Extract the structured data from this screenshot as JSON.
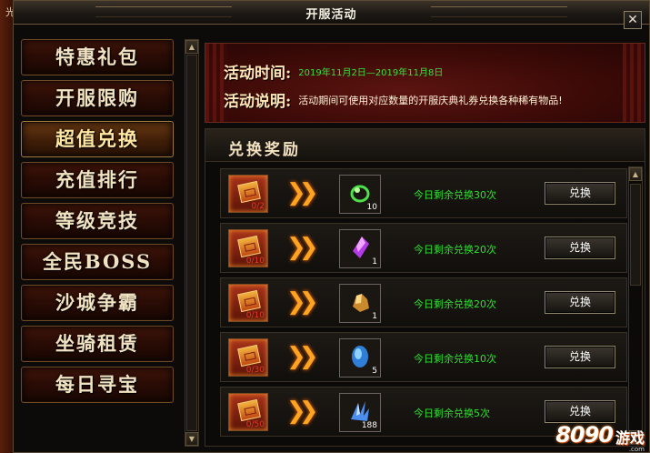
{
  "backdrop_label": "光",
  "window": {
    "title": "开服活动",
    "close_label": "✕"
  },
  "menu": {
    "items": [
      {
        "label": "特惠礼包"
      },
      {
        "label": "开服限购"
      },
      {
        "label": "超值兑换"
      },
      {
        "label": "充值排行"
      },
      {
        "label": "等级竞技"
      },
      {
        "label": "全民BOSS"
      },
      {
        "label": "沙城争霸"
      },
      {
        "label": "坐骑租赁"
      },
      {
        "label": "每日寻宝"
      }
    ],
    "active_index": 2
  },
  "activity": {
    "time_label": "活动时间:",
    "time_value": "2019年11月2日—2019年11月8日",
    "desc_label": "活动说明:",
    "desc_value": "活动期间可使用对应数量的开服庆典礼券兑换各种稀有物品!"
  },
  "rewards": {
    "title": "兑换奖励",
    "rows": [
      {
        "coupon_count": "0/2",
        "item_icon": "green-ring-icon",
        "item_qty": "10",
        "remaining": "今日剩余兑换30次",
        "button": "兑换"
      },
      {
        "coupon_count": "0/10",
        "item_icon": "purple-shard-icon",
        "item_qty": "1",
        "remaining": "今日剩余兑换20次",
        "button": "兑换"
      },
      {
        "coupon_count": "0/10",
        "item_icon": "gold-ore-icon",
        "item_qty": "1",
        "remaining": "今日剩余兑换20次",
        "button": "兑换"
      },
      {
        "coupon_count": "0/30",
        "item_icon": "blue-stone-icon",
        "item_qty": "5",
        "remaining": "今日剩余兑换10次",
        "button": "兑换"
      },
      {
        "coupon_count": "0/50",
        "item_icon": "blue-crystal-icon",
        "item_qty": "188",
        "remaining": "今日剩余兑换5次",
        "button": "兑换"
      }
    ]
  },
  "watermark": {
    "number": "8090",
    "text": "游戏",
    "sub": ".com"
  },
  "colors": {
    "accent_green": "#2fe030",
    "title_gold": "#ffe6b8",
    "arrow_orange": "#ffa420"
  }
}
